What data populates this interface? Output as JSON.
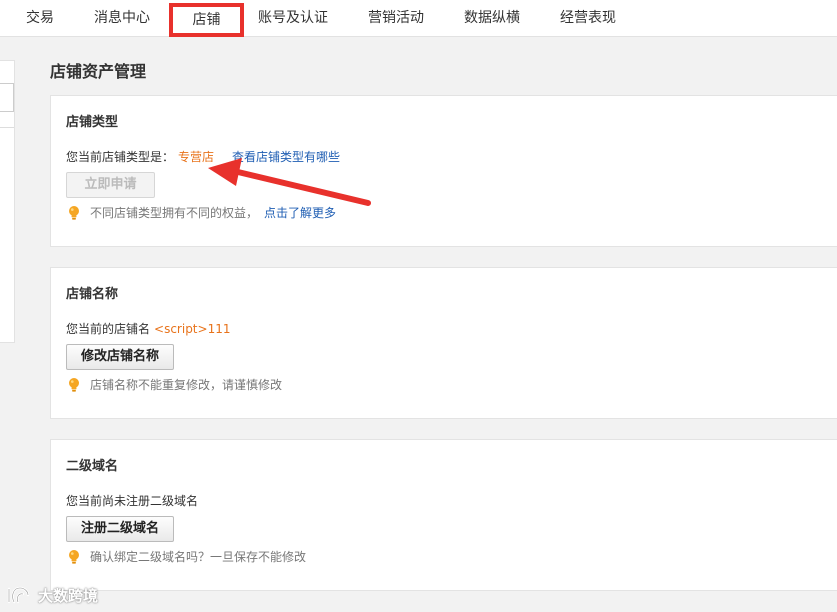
{
  "nav": {
    "tabs": [
      {
        "label": "交易"
      },
      {
        "label": "消息中心"
      },
      {
        "label": "店铺"
      },
      {
        "label": "账号及认证"
      },
      {
        "label": "营销活动"
      },
      {
        "label": "数据纵横"
      },
      {
        "label": "经营表现"
      }
    ],
    "active_index": 2
  },
  "page": {
    "title": "店铺资产管理"
  },
  "store_type": {
    "title": "店铺类型",
    "current_label": "您当前店铺类型是：",
    "current_value": "专营店",
    "view_types_link": "查看店铺类型有哪些",
    "apply_button": "立即申请",
    "tip_text": "不同店铺类型拥有不同的权益，",
    "tip_link": "点击了解更多"
  },
  "store_name": {
    "title": "店铺名称",
    "current_label": "您当前的店铺名",
    "current_value": "<script>111",
    "modify_button": "修改店铺名称",
    "tip_text": "店铺名称不能重复修改，请谨慎修改"
  },
  "subdomain": {
    "title": "二级域名",
    "status_text": "您当前尚未注册二级域名",
    "register_button": "注册二级域名",
    "tip_text": "确认绑定二级域名吗？一旦保存不能修改"
  },
  "watermark": {
    "text": "大数跨境"
  },
  "colors": {
    "highlight": "#e8731b",
    "link": "#1f5eb3",
    "annotation": "#e8312c",
    "tip_icon": "#f5a623"
  }
}
